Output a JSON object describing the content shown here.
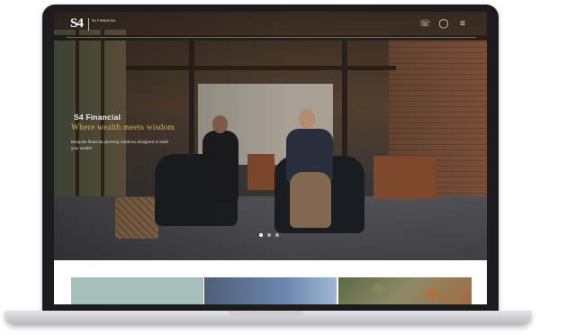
{
  "header": {
    "logo_mark": "S4",
    "logo_sub": "S4 FINANCIAL",
    "icons": [
      "phone-icon",
      "user-icon",
      "menu-icon"
    ]
  },
  "hero": {
    "brand": "S4 Financial",
    "title": "Where wealth meets wisdom",
    "body": "Bespoke financial planning solutions designed to build your wealth",
    "slides": 3,
    "active_slide": 0
  },
  "cards": [
    {
      "name": "card-1"
    },
    {
      "name": "card-2"
    },
    {
      "name": "card-3"
    }
  ],
  "colors": {
    "accent_gold": "#d9b25c",
    "laptop_frame": "#1c1c1e"
  }
}
